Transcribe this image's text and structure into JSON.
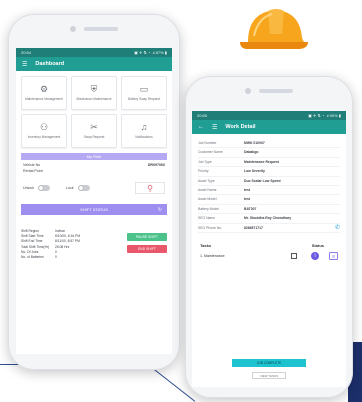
{
  "colors": {
    "accent": "#219e94",
    "statusbar": "#1f7e77",
    "purple": "#9d8ef0",
    "green": "#4cc38a",
    "red": "#e9586a",
    "cyan": "#1fc3cf"
  },
  "phone1": {
    "statusbar": {
      "time": "20:54",
      "icons": "▣ ✈ ⇅ ◔ .ıl 87% ▮"
    },
    "appbar": {
      "menu_icon": "menu-icon",
      "title": "Dashboard"
    },
    "tiles": [
      {
        "icon": "wrench-icon",
        "glyph": "⚙",
        "label": "Maintenance Management"
      },
      {
        "icon": "shield-icon",
        "glyph": "⛨",
        "label": "Breakdown Maintenance"
      },
      {
        "icon": "battery-icon",
        "glyph": "▭",
        "label": "Battery Swap Request"
      },
      {
        "icon": "people-icon",
        "glyph": "⚇",
        "label": "Inventory Management"
      },
      {
        "icon": "tools-icon",
        "glyph": "✂",
        "label": "Swap Request"
      },
      {
        "icon": "bell-icon",
        "glyph": "♫",
        "label": "Notifications"
      }
    ],
    "my_ride_label": "My Ride",
    "vehicle_no_label": "Vehicle No",
    "vehicle_no_value": "DR097060",
    "rental_point_label": "Rental Point",
    "unlock_label": "Unlock",
    "lock_label": "Lock",
    "shift_status_label": "SHIFT STATUS",
    "info_rows": [
      {
        "k": "Shift Region",
        "v": "Indivar"
      },
      {
        "k": "Shift Start Time",
        "v": "8/10/00, 6:16 PM"
      },
      {
        "k": "Shift End Time",
        "v": "8/11/00, 8:57 PM"
      },
      {
        "k": "Total Shift Time(Hr)",
        "v": "26:08 Hrs"
      },
      {
        "k": "No. Of Jobs",
        "v": "0"
      },
      {
        "k": "No. of Batteries",
        "v": "0"
      }
    ],
    "pause_shift_label": "PAUSE SHIFT",
    "end_shift_label": "END SHIFT"
  },
  "phone2": {
    "statusbar": {
      "time": "20:55",
      "icons": "▣ ✈ ⇅ ◔ .ıl 90% ▮"
    },
    "appbar": {
      "back_icon": "back-arrow-icon",
      "menu_icon": "menu-icon",
      "title": "Work Detail"
    },
    "details": [
      {
        "k": "Job Number",
        "v": "MWK 010007"
      },
      {
        "k": "Customer Name",
        "v": "Dababgo"
      },
      {
        "k": "Job Type",
        "v": "Maintenance Request"
      },
      {
        "k": "Priority",
        "v": "Low Severity"
      },
      {
        "k": "Asset Type",
        "v": "Duo Scalar Low Speed"
      },
      {
        "k": "Asset Name",
        "v": "test"
      },
      {
        "k": "Asset Model",
        "v": "test"
      },
      {
        "k": "Battery Model",
        "v": "BAT007"
      },
      {
        "k": "SEO Name",
        "v": "Mr. Shuddha Roy Chowdhary"
      },
      {
        "k": "SEO Phone No.",
        "v": "8266571717"
      }
    ],
    "tasks_header": "Tasks",
    "status_header": "Status",
    "task_name": "1. Maintenance",
    "job_complete_label": "JOB COMPLETE",
    "view_tasks_label": "VIEW TASKS"
  }
}
